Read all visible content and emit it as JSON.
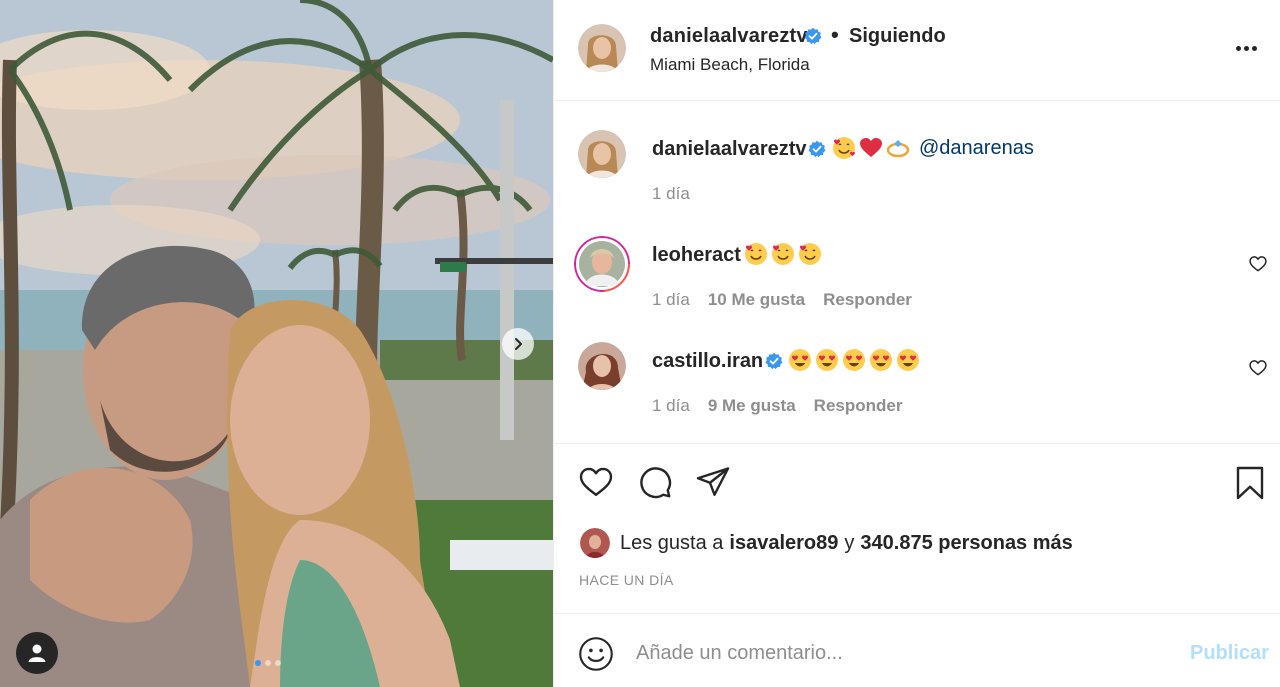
{
  "post": {
    "photo_alt": "",
    "carousel": {
      "count": 3,
      "active_index": 0
    }
  },
  "header": {
    "username": "danielaalvareztv",
    "verified": true,
    "separator": "•",
    "follow_status": "Siguiendo",
    "location": "Miami Beach, Florida"
  },
  "caption": {
    "username": "danielaalvareztv",
    "verified": true,
    "emojis": [
      "smiling-face-with-hearts",
      "red-heart",
      "ring"
    ],
    "mention": "@danarenas",
    "time": "1 día"
  },
  "comments": [
    {
      "username": "leoheract",
      "verified": false,
      "emojis": [
        "smiling-face-with-hearts",
        "smiling-face-with-hearts",
        "smiling-face-with-hearts"
      ],
      "time": "1 día",
      "likes": "10 Me gusta",
      "reply_label": "Responder"
    },
    {
      "username": "castillo.iran",
      "verified": true,
      "emojis": [
        "heart-eyes",
        "heart-eyes",
        "heart-eyes",
        "heart-eyes",
        "heart-eyes"
      ],
      "time": "1 día",
      "likes": "9 Me gusta",
      "reply_label": "Responder"
    }
  ],
  "likes": {
    "prefix": "Les gusta a",
    "user": "isavalero89",
    "connector": "y",
    "others": "340.875 personas más"
  },
  "timestamp": "HACE UN DÍA",
  "add_comment": {
    "placeholder": "Añade un comentario...",
    "publish_label": "Publicar"
  },
  "colors": {
    "accent": "#3897f0",
    "text": "#262626",
    "muted": "#8e8e8e",
    "publish_disabled": "#b2dffc",
    "mention": "#00376b"
  }
}
